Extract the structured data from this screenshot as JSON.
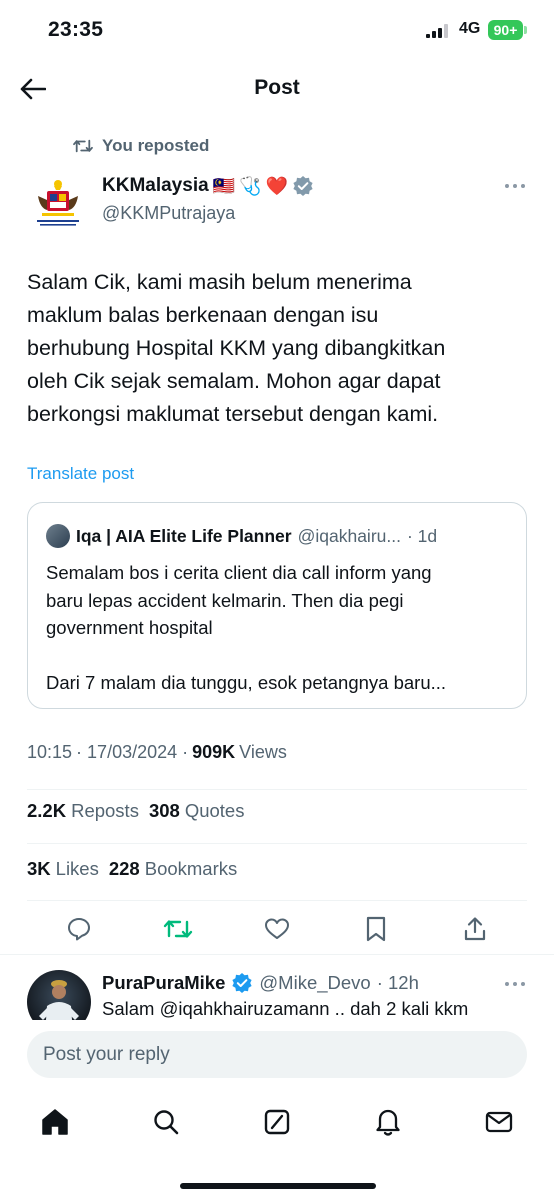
{
  "status_bar": {
    "time": "23:35",
    "network": "4G",
    "battery": "90+"
  },
  "header": {
    "title": "Post",
    "back_icon": "arrow-left-icon"
  },
  "repost": {
    "label": "You reposted",
    "icon": "repost-icon"
  },
  "author": {
    "name": "KKMalaysia",
    "emojis": [
      "🇲🇾",
      "🩺",
      "❤️"
    ],
    "handle": "@KKMPutrajaya",
    "verified_color": "#829aab"
  },
  "post": {
    "text": "Salam Cik, kami masih belum menerima\nmaklum balas berkenaan dengan isu\nberhubung Hospital KKM yang dibangkitkan\noleh Cik sejak semalam.  Mohon agar dapat\nberkongsi maklumat tersebut dengan kami.",
    "translate_label": "Translate post"
  },
  "quote": {
    "name": "Iqa | AIA Elite Life Planner",
    "handle": "@iqakhairu...",
    "time": "· 1d",
    "text": "Semalam bos i cerita client dia call inform yang\nbaru lepas accident kelmarin. Then dia pegi\ngovernment hospital\n\nDari 7 malam dia tunggu, esok petangnya baru..."
  },
  "meta": {
    "time": "10:15",
    "date": "· 17/03/2024 ·",
    "views_count": "909K",
    "views_label": "Views"
  },
  "stats": {
    "reposts_count": "2.2K",
    "reposts_label": "Reposts",
    "quotes_count": "308",
    "quotes_label": "Quotes",
    "likes_count": "3K",
    "likes_label": "Likes",
    "bookmarks_count": "228",
    "bookmarks_label": "Bookmarks"
  },
  "colors": {
    "accent": "#1d9bf0",
    "repost_active": "#00ba7c",
    "muted": "#536471",
    "text": "#0f1419"
  },
  "reply_preview": {
    "name": "PuraPuraMike",
    "handle": "@Mike_Devo",
    "time": "· 12h",
    "text": "Salam @iqahkhairuzamann .. dah 2 kali kkm",
    "verified_color": "#1d9bf0"
  },
  "composer": {
    "placeholder": "Post your reply"
  },
  "bottom_nav": [
    "home-icon",
    "search-icon",
    "grok-icon",
    "notifications-icon",
    "messages-icon"
  ]
}
